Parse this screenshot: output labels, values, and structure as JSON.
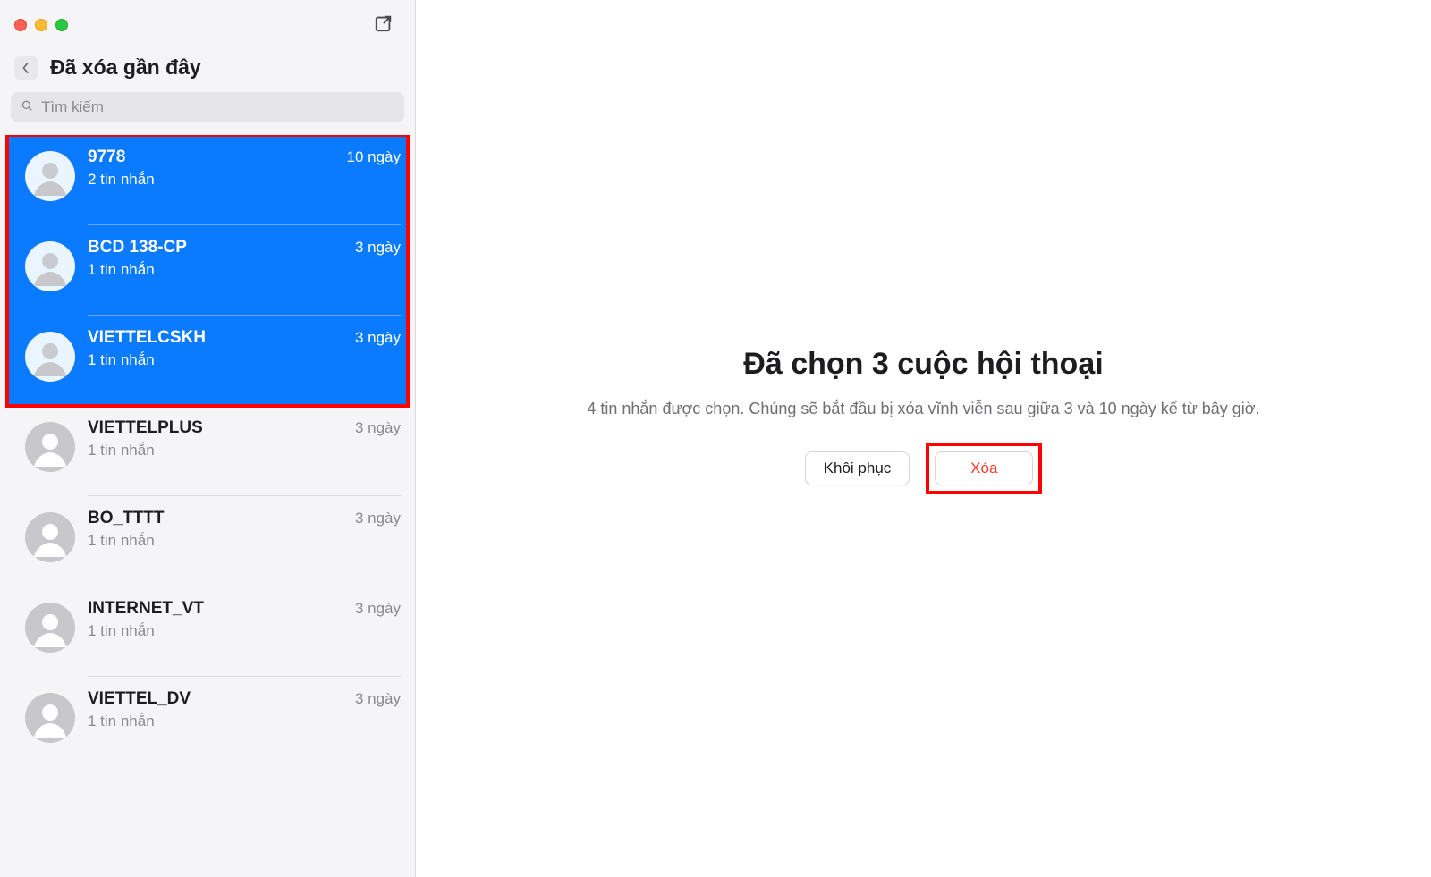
{
  "sidebar": {
    "title": "Đã xóa gần đây",
    "search_placeholder": "Tìm kiếm",
    "items": [
      {
        "name": "9778",
        "subtitle": "2 tin nhắn",
        "time": "10 ngày",
        "selected": true
      },
      {
        "name": "BCD 138-CP",
        "subtitle": "1 tin nhắn",
        "time": "3 ngày",
        "selected": true
      },
      {
        "name": "VIETTELCSKH",
        "subtitle": "1 tin nhắn",
        "time": "3 ngày",
        "selected": true
      },
      {
        "name": "VIETTELPLUS",
        "subtitle": "1 tin nhắn",
        "time": "3 ngày",
        "selected": false
      },
      {
        "name": "BO_TTTT",
        "subtitle": "1 tin nhắn",
        "time": "3 ngày",
        "selected": false
      },
      {
        "name": "INTERNET_VT",
        "subtitle": "1 tin nhắn",
        "time": "3 ngày",
        "selected": false
      },
      {
        "name": "VIETTEL_DV",
        "subtitle": "1 tin nhắn",
        "time": "3 ngày",
        "selected": false
      }
    ]
  },
  "main": {
    "heading": "Đã chọn 3 cuộc hội thoại",
    "description": "4 tin nhắn được chọn. Chúng sẽ bắt đầu bị xóa vĩnh viễn sau giữa 3 và 10 ngày kể từ bây giờ.",
    "recover_label": "Khôi phục",
    "delete_label": "Xóa"
  }
}
